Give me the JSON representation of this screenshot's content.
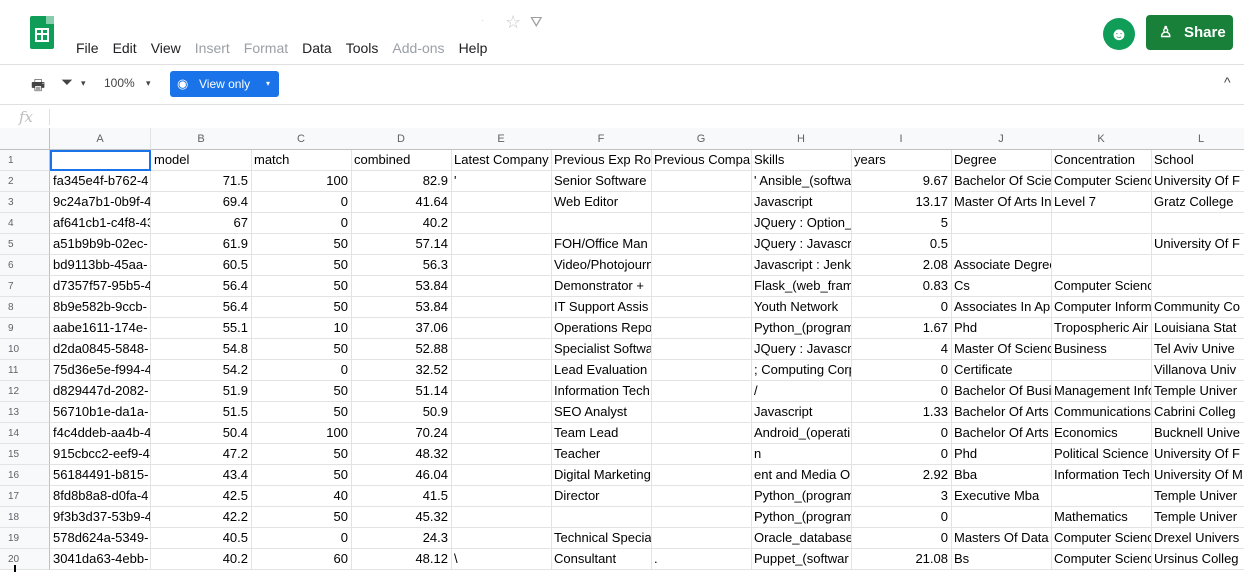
{
  "app": {
    "menu": [
      {
        "label": "File",
        "enabled": true
      },
      {
        "label": "Edit",
        "enabled": true
      },
      {
        "label": "View",
        "enabled": true
      },
      {
        "label": "Insert",
        "enabled": false
      },
      {
        "label": "Format",
        "enabled": false
      },
      {
        "label": "Data",
        "enabled": true
      },
      {
        "label": "Tools",
        "enabled": true
      },
      {
        "label": "Add-ons",
        "enabled": false
      },
      {
        "label": "Help",
        "enabled": true
      }
    ],
    "share_label": "Share",
    "icons": {
      "logo": "sheets-logo",
      "star": "star-icon",
      "drive": "drive-icon",
      "avatar": "user-avatar-icon",
      "lock": "person-lock-icon"
    }
  },
  "toolbar": {
    "zoom": "100%",
    "view_only_label": "View only",
    "icons": [
      "print-icon",
      "filter-icon",
      "eye-icon",
      "collapse-icon"
    ]
  },
  "formula_bar": {
    "fx_label": "fx"
  },
  "sheet": {
    "columns": [
      "A",
      "B",
      "C",
      "D",
      "E",
      "F",
      "G",
      "H",
      "I",
      "J",
      "K",
      "L"
    ],
    "row_numbers": [
      "1",
      "2",
      "3",
      "4",
      "5",
      "6",
      "7",
      "8",
      "9",
      "10",
      "11",
      "12",
      "13",
      "14",
      "15",
      "16",
      "17",
      "18",
      "19",
      "20"
    ],
    "header_row": [
      "",
      "model",
      "match",
      "combined",
      "Latest Company",
      "Previous Exp Ro",
      "Previous Compa",
      "Skills",
      "years",
      "Degree",
      "Concentration",
      "School"
    ],
    "rows": [
      [
        "fa345e4f-b762-4",
        "71.5",
        "100",
        "82.9",
        "'",
        "Senior Software",
        "",
        "' Ansible_(softwar",
        "9.67",
        "Bachelor Of Scie",
        "Computer Scienc",
        "University Of F"
      ],
      [
        "9c24a7b1-0b9f-4",
        "69.4",
        "0",
        "41.64",
        "",
        "Web Editor",
        "",
        "Javascript",
        "13.17",
        "Master Of Arts In",
        "Level 7",
        "Gratz College"
      ],
      [
        "af641cb1-c4f8-43",
        "67",
        "0",
        "40.2",
        "",
        "",
        "",
        "JQuery : Option_",
        "5",
        "",
        "",
        ""
      ],
      [
        "a51b9b9b-02ec-",
        "61.9",
        "50",
        "57.14",
        "",
        "FOH/Office Man",
        "",
        "JQuery : Javascr",
        "0.5",
        "",
        "",
        "University Of F"
      ],
      [
        "bd9113bb-45aa-",
        "60.5",
        "50",
        "56.3",
        "",
        "Video/Photojourn",
        "",
        "Javascript : Jenk",
        "2.08",
        "Associate Degree",
        "",
        ""
      ],
      [
        "d7357f57-95b5-4",
        "56.4",
        "50",
        "53.84",
        "",
        "Demonstrator + ",
        "",
        "Flask_(web_fram",
        "0.83",
        "Cs",
        "Computer Science",
        ""
      ],
      [
        "8b9e582b-9ccb-",
        "56.4",
        "50",
        "53.84",
        "",
        "IT Support Assis",
        "",
        "Youth Network",
        "0",
        "Associates In Ap",
        "Computer Inform",
        "Community Co"
      ],
      [
        "aabe1611-174e-",
        "55.1",
        "10",
        "37.06",
        "",
        "Operations Repo",
        "",
        "Python_(program",
        "1.67",
        "Phd",
        "Tropospheric Air",
        "Louisiana Stat"
      ],
      [
        "d2da0845-5848-",
        "54.8",
        "50",
        "52.88",
        "",
        "Specialist Softwa",
        "",
        "JQuery : Javascr",
        "4",
        "Master Of Scienc",
        "Business",
        "Tel Aviv Unive"
      ],
      [
        "75d36e5e-f994-4",
        "54.2",
        "0",
        "32.52",
        "",
        "Lead Evaluation",
        "",
        "; Computing Corp",
        "0",
        "Certificate",
        "",
        "Villanova Univ"
      ],
      [
        "d829447d-2082-",
        "51.9",
        "50",
        "51.14",
        "",
        "Information Tech",
        "",
        "/",
        "0",
        "Bachelor Of Busi",
        "Management Info",
        "Temple Univer"
      ],
      [
        "56710b1e-da1a-",
        "51.5",
        "50",
        "50.9",
        "",
        "SEO Analyst",
        "",
        "Javascript",
        "1.33",
        "Bachelor Of Arts",
        "Communications",
        "Cabrini Colleg"
      ],
      [
        "f4c4ddeb-aa4b-4",
        "50.4",
        "100",
        "70.24",
        "",
        "Team Lead",
        "",
        "Android_(operati",
        "0",
        "Bachelor Of Arts",
        "Economics",
        "Bucknell Unive"
      ],
      [
        "915cbcc2-eef9-4",
        "47.2",
        "50",
        "48.32",
        "",
        "Teacher",
        "",
        "n",
        "0",
        "Phd",
        "Political Science",
        "University Of F"
      ],
      [
        "56184491-b815-",
        "43.4",
        "50",
        "46.04",
        "",
        "Digital Marketing",
        "",
        "ent and Media Op",
        "2.92",
        "Bba",
        "Information Tech",
        "University Of M"
      ],
      [
        "8fd8b8a8-d0fa-4",
        "42.5",
        "40",
        "41.5",
        "",
        "Director",
        "",
        "Python_(program",
        "3",
        "Executive Mba",
        "",
        "Temple Univer"
      ],
      [
        "9f3b3d37-53b9-4",
        "42.2",
        "50",
        "45.32",
        "",
        "",
        "",
        "Python_(program",
        "0",
        "",
        "Mathematics",
        "Temple Univer"
      ],
      [
        "578d624a-5349-",
        "40.5",
        "0",
        "24.3",
        "",
        "Technical Specia",
        "",
        "Oracle_database",
        "0",
        "Masters Of Data",
        "Computer Scienc",
        "Drexel Univers"
      ],
      [
        "3041da63-4ebb-",
        "40.2",
        "60",
        "48.12",
        "\\",
        "Consultant",
        ".",
        "Puppet_(softwar",
        "21.08",
        "Bs",
        "Computer Scienc",
        "Ursinus Colleg"
      ]
    ]
  }
}
